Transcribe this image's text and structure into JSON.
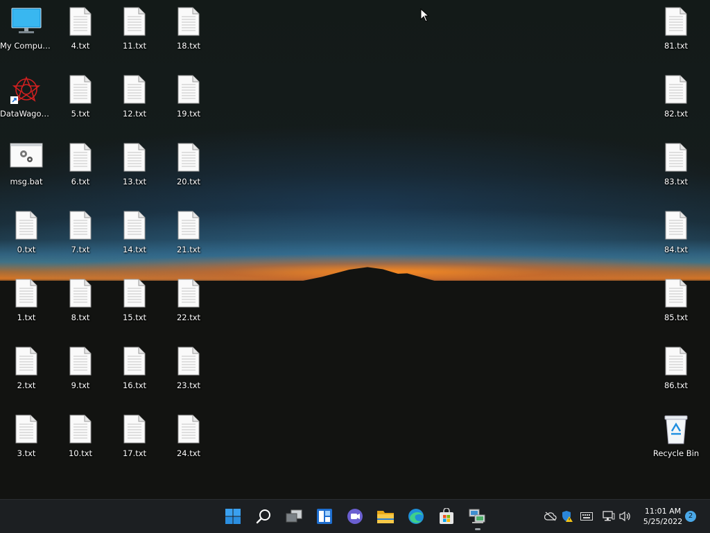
{
  "desktop": {
    "icons_left": [
      {
        "name": "my-computer",
        "label": "My Computer",
        "type": "computer"
      },
      {
        "name": "datawagon",
        "label": "DataWagon...",
        "type": "app"
      },
      {
        "name": "msg-bat",
        "label": "msg.bat",
        "type": "bat"
      },
      {
        "name": "file-0",
        "label": "0.txt",
        "type": "txt"
      },
      {
        "name": "file-1",
        "label": "1.txt",
        "type": "txt"
      },
      {
        "name": "file-2",
        "label": "2.txt",
        "type": "txt"
      },
      {
        "name": "file-3",
        "label": "3.txt",
        "type": "txt"
      },
      {
        "name": "file-4",
        "label": "4.txt",
        "type": "txt"
      },
      {
        "name": "file-5",
        "label": "5.txt",
        "type": "txt"
      },
      {
        "name": "file-6",
        "label": "6.txt",
        "type": "txt"
      },
      {
        "name": "file-7",
        "label": "7.txt",
        "type": "txt"
      },
      {
        "name": "file-8",
        "label": "8.txt",
        "type": "txt"
      },
      {
        "name": "file-9",
        "label": "9.txt",
        "type": "txt"
      },
      {
        "name": "file-10",
        "label": "10.txt",
        "type": "txt"
      },
      {
        "name": "file-11",
        "label": "11.txt",
        "type": "txt"
      },
      {
        "name": "file-12",
        "label": "12.txt",
        "type": "txt"
      },
      {
        "name": "file-13",
        "label": "13.txt",
        "type": "txt"
      },
      {
        "name": "file-14",
        "label": "14.txt",
        "type": "txt"
      },
      {
        "name": "file-15",
        "label": "15.txt",
        "type": "txt"
      },
      {
        "name": "file-16",
        "label": "16.txt",
        "type": "txt"
      },
      {
        "name": "file-17",
        "label": "17.txt",
        "type": "txt"
      },
      {
        "name": "file-18",
        "label": "18.txt",
        "type": "txt"
      },
      {
        "name": "file-19",
        "label": "19.txt",
        "type": "txt"
      },
      {
        "name": "file-20",
        "label": "20.txt",
        "type": "txt"
      },
      {
        "name": "file-21",
        "label": "21.txt",
        "type": "txt"
      },
      {
        "name": "file-22",
        "label": "22.txt",
        "type": "txt"
      },
      {
        "name": "file-23",
        "label": "23.txt",
        "type": "txt"
      },
      {
        "name": "file-24",
        "label": "24.txt",
        "type": "txt"
      }
    ],
    "icons_right": [
      {
        "name": "file-81",
        "label": "81.txt",
        "type": "txt"
      },
      {
        "name": "file-82",
        "label": "82.txt",
        "type": "txt"
      },
      {
        "name": "file-83",
        "label": "83.txt",
        "type": "txt"
      },
      {
        "name": "file-84",
        "label": "84.txt",
        "type": "txt"
      },
      {
        "name": "file-85",
        "label": "85.txt",
        "type": "txt"
      },
      {
        "name": "file-86",
        "label": "86.txt",
        "type": "txt"
      },
      {
        "name": "recycle-bin",
        "label": "Recycle Bin",
        "type": "recycle"
      }
    ]
  },
  "taskbar": {
    "buttons": [
      {
        "name": "start-button",
        "icon": "windows-start-icon"
      },
      {
        "name": "search-button",
        "icon": "search-icon"
      },
      {
        "name": "task-view-button",
        "icon": "task-view-icon"
      },
      {
        "name": "widgets-button",
        "icon": "widgets-icon"
      },
      {
        "name": "chat-button",
        "icon": "chat-icon"
      },
      {
        "name": "file-explorer-button",
        "icon": "folder-icon"
      },
      {
        "name": "edge-button",
        "icon": "edge-icon"
      },
      {
        "name": "store-button",
        "icon": "store-icon"
      },
      {
        "name": "network-app-button",
        "icon": "network-app-icon"
      }
    ],
    "tray": [
      "onedrive-offline-icon",
      "security-warning-icon",
      "keyboard-icon",
      "network-icon",
      "volume-icon"
    ],
    "clock": {
      "time": "11:01 AM",
      "date": "5/25/2022"
    },
    "notification_count": "2"
  }
}
